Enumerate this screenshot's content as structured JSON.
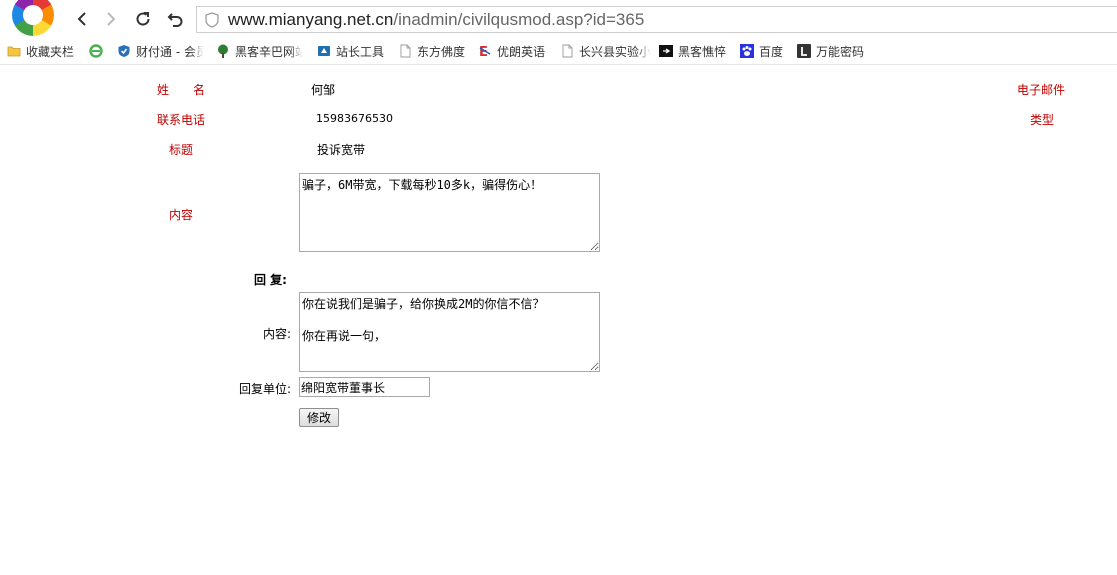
{
  "browser": {
    "url_host": "www.mianyang.net.cn",
    "url_path": "/inadmin/civilqusmod.asp?id=365",
    "bookmarks": [
      {
        "label": "收藏夹栏",
        "icon": "folder-icon"
      },
      {
        "label": "",
        "icon": "ie-icon"
      },
      {
        "label": "财付通 - 会员",
        "icon": "shield-icon"
      },
      {
        "label": "黑客辛巴网站",
        "icon": "tree-icon"
      },
      {
        "label": "站长工具",
        "icon": "tool-icon"
      },
      {
        "label": "东方佛度",
        "icon": "page-icon"
      },
      {
        "label": "优朗英语",
        "icon": "e-icon"
      },
      {
        "label": "长兴县实验小",
        "icon": "page-icon"
      },
      {
        "label": "黑客憔悴",
        "icon": "black-icon"
      },
      {
        "label": "百度",
        "icon": "paw-icon"
      },
      {
        "label": "万能密码",
        "icon": "l-icon"
      }
    ]
  },
  "form": {
    "name_label": "姓　　名",
    "name_value": "何邹",
    "email_label": "电子邮件",
    "phone_label": "联系电话",
    "phone_value": "15983676530",
    "type_label": "类型",
    "title_label": "标题",
    "title_value": "投诉宽带",
    "content_label": "内容",
    "content_value": "骗子，6M带宽，下载每秒10多k，骗得伤心！",
    "reply_heading": "回 复:",
    "reply_content_label": "内容:",
    "reply_content_value": "你在说我们是骗子，给你换成2M的你信不信？\n\n你在再说一句，",
    "reply_unit_label": "回复单位:",
    "reply_unit_value": "绵阳宽带董事长",
    "submit_label": "修改"
  },
  "colors": {
    "label_red": "#c00000"
  }
}
